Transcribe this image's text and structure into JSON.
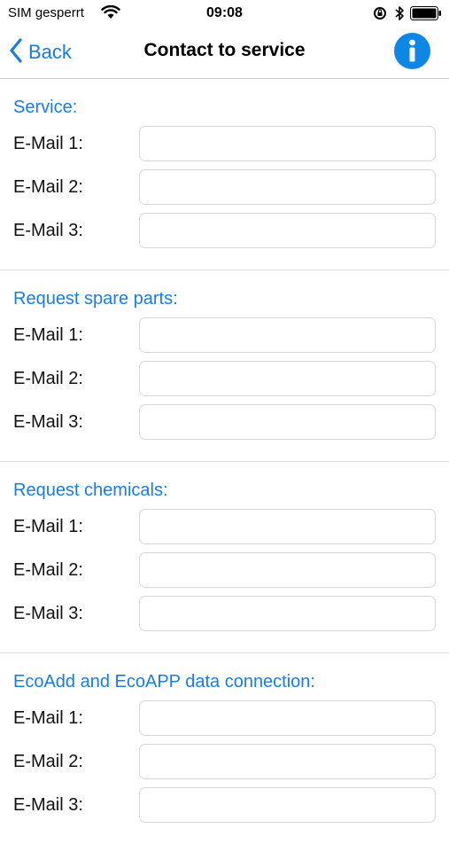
{
  "status_bar": {
    "carrier": "SIM gesperrt",
    "time": "09:08"
  },
  "nav": {
    "back_label": "Back",
    "title": "Contact to service",
    "info_icon": "info-icon"
  },
  "colors": {
    "accent": "#1a7de0",
    "info_button": "#0d86e6",
    "separator": "#dcdcdc"
  },
  "sections": [
    {
      "title": "Service:",
      "fields": [
        {
          "label": "E-Mail 1:",
          "value": ""
        },
        {
          "label": "E-Mail 2:",
          "value": ""
        },
        {
          "label": "E-Mail 3:",
          "value": ""
        }
      ]
    },
    {
      "title": "Request spare parts:",
      "fields": [
        {
          "label": "E-Mail 1:",
          "value": ""
        },
        {
          "label": "E-Mail 2:",
          "value": ""
        },
        {
          "label": "E-Mail 3:",
          "value": ""
        }
      ]
    },
    {
      "title": "Request chemicals:",
      "fields": [
        {
          "label": "E-Mail 1:",
          "value": ""
        },
        {
          "label": "E-Mail 2:",
          "value": ""
        },
        {
          "label": "E-Mail 3:",
          "value": ""
        }
      ]
    },
    {
      "title": "EcoAdd and EcoAPP data connection:",
      "fields": [
        {
          "label": "E-Mail 1:",
          "value": ""
        },
        {
          "label": "E-Mail 2:",
          "value": ""
        },
        {
          "label": "E-Mail 3:",
          "value": ""
        }
      ]
    }
  ]
}
